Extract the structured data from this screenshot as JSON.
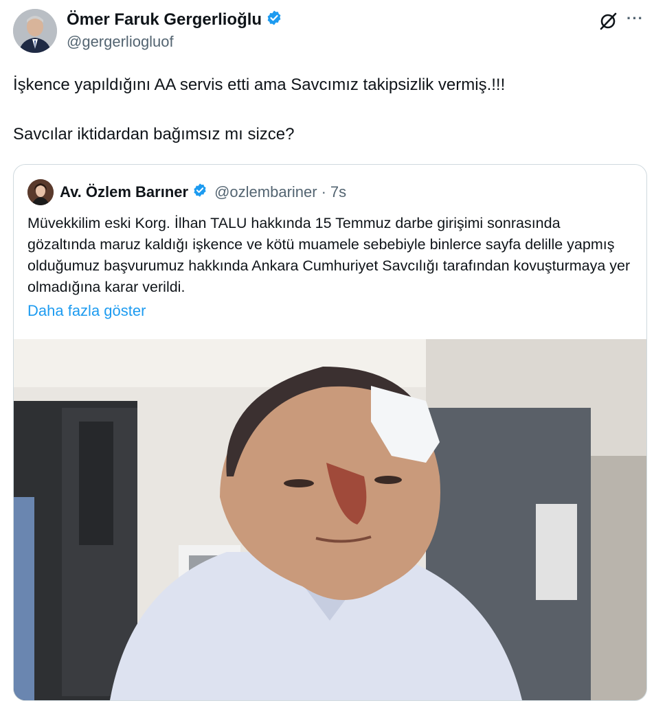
{
  "author": {
    "name": "Ömer Faruk Gergerlioğlu",
    "handle": "@gergerliogluof",
    "verified_icon": "verified-badge-icon"
  },
  "header_actions": {
    "grok_icon": "grok-icon",
    "more_label": "···"
  },
  "tweet": {
    "paragraph1": "İşkence yapıldığını AA servis etti ama Savcımız takipsizlik vermiş.!!!",
    "paragraph2": "Savcılar iktidardan bağımsız mı sizce?"
  },
  "quote": {
    "name": "Av. Özlem Barıner",
    "handle": "@ozlembariner",
    "separator": "·",
    "time": "7s",
    "text": "Müvekkilim eski Korg. İlhan TALU hakkında 15 Temmuz darbe girişimi sonrasında gözaltında maruz kaldığı işkence ve kötü muamele sebebiyle binlerce sayfa delille yapmış olduğumuz başvurumuz hakkında Ankara Cumhuriyet Savcılığı tarafından  kovuşturmaya yer olmadığına karar verildi.",
    "show_more": "Daha fazla göster",
    "media_icon": "photo-of-injured-man"
  },
  "colors": {
    "text": "#0f1419",
    "secondary": "#536471",
    "link": "#1d9bf0",
    "verified": "#1d9bf0",
    "border": "#cfd9de"
  }
}
